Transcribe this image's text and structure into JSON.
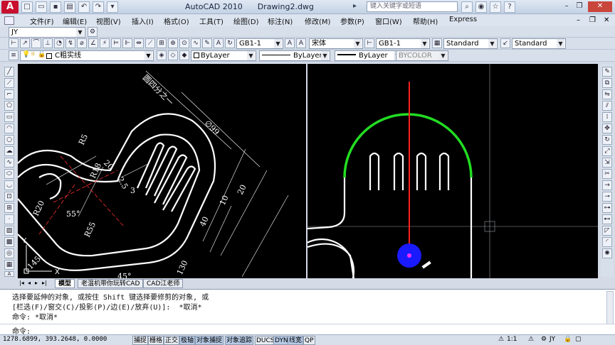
{
  "app": {
    "logo": "A",
    "title": "AutoCAD 2010",
    "document": "Drawing2.dwg",
    "search_placeholder": "键入关键字或短语"
  },
  "menu": [
    "文件(F)",
    "编辑(E)",
    "视图(V)",
    "插入(I)",
    "格式(O)",
    "工具(T)",
    "绘图(D)",
    "标注(N)",
    "修改(M)",
    "参数(P)",
    "窗口(W)",
    "帮助(H)",
    "Express"
  ],
  "toolbar1": {
    "workspace": "JY"
  },
  "toolbar2": {
    "text_style": "GB1-1",
    "font": "宋体",
    "dim_style": "GB1-1",
    "table_style": "Standard",
    "multileader_style": "Standard"
  },
  "toolbar3": {
    "layer": "C粗实线",
    "color": "ByLayer",
    "linetype": "ByLayer",
    "lineweight": "ByLayer",
    "plotstyle": "BYCOLOR"
  },
  "drawing_left": {
    "ucs_y": "Y",
    "ucs_x": "X",
    "dims": [
      "圆四分之一",
      "∅99",
      "R5",
      "R18",
      "20",
      "2.5",
      "3",
      "R20",
      "55°",
      "R55",
      "10",
      "20",
      "40",
      "145",
      "130",
      "45°"
    ]
  },
  "drawing_right": {
    "ucs_y": "Y",
    "ucs_x": "X",
    "colors": {
      "arc": "#22dd22",
      "axis": "#ff2020",
      "grip": "#1a1aff"
    }
  },
  "tabs": [
    "模型",
    "老温机带你玩转CAD",
    "CAD江老师"
  ],
  "command_lines": [
    "选择要延伸的对象, 或按住 Shift 键选择要修剪的对象, 或",
    "[栏选(F)/窗交(C)/投影(P)/边(E)/放弃(U)]:  *取消*",
    "命令: *取消*"
  ],
  "command_prompt": "命令:",
  "status": {
    "coords": "1278.6899, 393.2648, 0.0000",
    "toggles": [
      "捕捉",
      "栅格",
      "正交",
      "极轴",
      "对象捕捉",
      "对象追踪",
      "DUCS",
      "DYN",
      "线宽",
      "QP"
    ],
    "scale": "1:1",
    "workspace": "JY"
  }
}
